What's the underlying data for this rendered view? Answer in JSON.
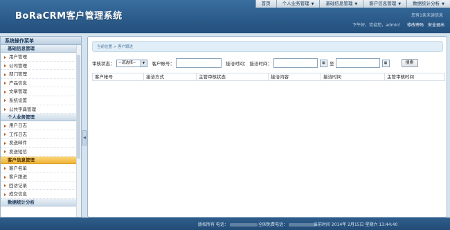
{
  "app": {
    "title": "BoRaCRM客户管理系统"
  },
  "topnav": {
    "items": [
      {
        "label": "首页",
        "has_menu": false
      },
      {
        "label": "个人业务管理",
        "has_menu": true
      },
      {
        "label": "基础信息管理",
        "has_menu": true
      },
      {
        "label": "客户信息管理",
        "has_menu": true
      },
      {
        "label": "数据统计分析",
        "has_menu": true
      }
    ],
    "caret": "▼"
  },
  "header": {
    "unread": "您有1条未读信息",
    "greeting": "下午好，欢迎您，admin！",
    "change_password": "修改密码",
    "logout": "安全退出"
  },
  "sidebar": {
    "title": "系统操作菜单",
    "groups": [
      {
        "label": "基础信息管理",
        "items": [
          "用户管理",
          "公司管理",
          "部门管理",
          "产品信息",
          "文章管理",
          "系统设置",
          "公共字典管理"
        ]
      },
      {
        "label": "个人业务管理",
        "items": [
          "用户日志",
          "工作日志",
          "发送邮件",
          "发送短信"
        ]
      },
      {
        "label": "客户信息管理",
        "active": true,
        "items": [
          "客户名单",
          "客户跟进",
          "回访记录",
          "成交信息"
        ]
      },
      {
        "label": "数据统计分析",
        "items": []
      }
    ]
  },
  "main": {
    "breadcrumb": "当前位置 > 客户跟进",
    "search": {
      "status_label": "审核状态：",
      "status_select": "--请选择--",
      "account_label": "客户帐号：",
      "method_label": "接洽时间：",
      "time_label": "接洽时间：",
      "to_label": "至",
      "button": "搜索",
      "date_icon": "▦"
    },
    "table": {
      "columns": [
        "客户帐号",
        "接洽方式",
        "主管审核状态",
        "接洽内容",
        "接洽时间",
        "主管审核时间"
      ],
      "rows": []
    },
    "collapse_icon": "◀"
  },
  "footer": {
    "copyright": "版权所有 电话：",
    "phone": "全国免费电话：",
    "time": "当前时间 2014年 2月15日 星期六 13:44:40"
  },
  "colors": {
    "header_bg": "#2e5f8f",
    "active_group": "#f0b236",
    "footer_bg": "#2a5582"
  }
}
